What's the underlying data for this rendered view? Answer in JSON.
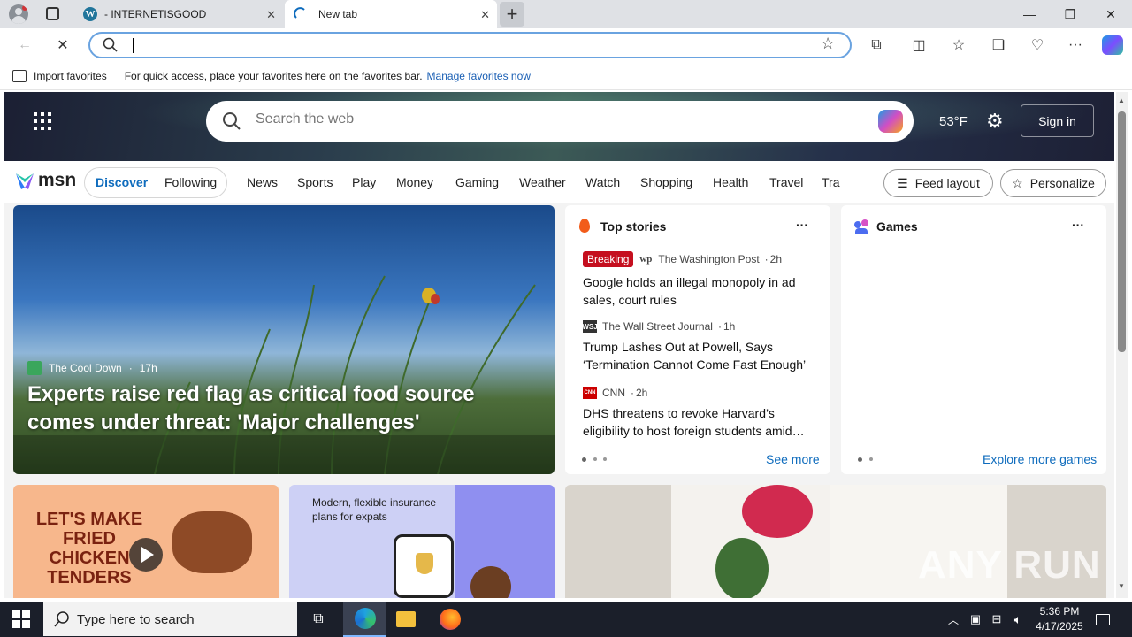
{
  "browser": {
    "tabs": [
      {
        "label": "- INTERNETISGOOD"
      },
      {
        "label": "New tab"
      }
    ],
    "address": {
      "value": "",
      "placeholder": ""
    }
  },
  "favorites_bar": {
    "import_label": "Import favorites",
    "hint": "For quick access, place your favorites here on the favorites bar.",
    "manage_link": "Manage favorites now"
  },
  "msn": {
    "search_placeholder": "Search the web",
    "weather": "53°F",
    "sign_in": "Sign in",
    "logo": "msn",
    "pill_tabs": [
      "Discover",
      "Following"
    ],
    "nav": [
      "News",
      "Sports",
      "Play",
      "Money",
      "Gaming",
      "Weather",
      "Watch",
      "Shopping",
      "Health",
      "Travel",
      "Tra"
    ],
    "feed_layout": "Feed layout",
    "personalize": "Personalize"
  },
  "hero_story": {
    "source": "The Cool Down",
    "time": "17h",
    "headline": "Experts raise red flag as critical food source comes under threat: 'Major challenges'"
  },
  "top_stories": {
    "title": "Top stories",
    "items": [
      {
        "badge": "Breaking",
        "source": "The Washington Post",
        "time": "2h",
        "headline": "Google holds an illegal monopoly in ad sales, court rules",
        "logo": "wp"
      },
      {
        "source": "The Wall Street Journal",
        "time": "1h",
        "headline": "Trump Lashes Out at Powell, Says ‘Termination Cannot Come Fast Enough’",
        "logo": "WSJ"
      },
      {
        "source": "CNN",
        "time": "2h",
        "headline": "DHS threatens to revoke Harvard’s eligibility to host foreign students amid…",
        "logo": "CNN"
      }
    ],
    "see_more": "See more"
  },
  "games": {
    "title": "Games",
    "explore": "Explore more games"
  },
  "promos": {
    "food_text": "LET'S MAKE FRIED CHICKEN TENDERS",
    "insurance_text": "Modern, flexible insurance plans for expats"
  },
  "watermark": "ANY RUN",
  "taskbar": {
    "search_placeholder": "Type here to search",
    "time": "5:36 PM",
    "date": "4/17/2025"
  },
  "colors": {
    "accent": "#0f6cbd",
    "breaking": "#c50f1f"
  }
}
